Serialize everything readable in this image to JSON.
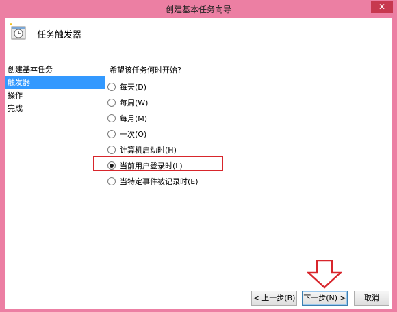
{
  "window": {
    "title": "创建基本任务向导",
    "close_label": "✕"
  },
  "header": {
    "title": "任务触发器",
    "icon": "task-scheduler-icon"
  },
  "sidebar": {
    "items": [
      {
        "label": "创建基本任务",
        "active": false
      },
      {
        "label": "触发器",
        "active": true
      },
      {
        "label": "操作",
        "active": false
      },
      {
        "label": "完成",
        "active": false
      }
    ]
  },
  "content": {
    "question": "希望该任务何时开始?",
    "options": [
      {
        "label": "每天(D)",
        "selected": false
      },
      {
        "label": "每周(W)",
        "selected": false
      },
      {
        "label": "每月(M)",
        "selected": false
      },
      {
        "label": "一次(O)",
        "selected": false
      },
      {
        "label": "计算机启动时(H)",
        "selected": false
      },
      {
        "label": "当前用户登录时(L)",
        "selected": true
      },
      {
        "label": "当特定事件被记录时(E)",
        "selected": false
      }
    ]
  },
  "footer": {
    "back_label": "< 上一步(B)",
    "next_label": "下一步(N) >",
    "cancel_label": "取消"
  },
  "colors": {
    "frame": "#ec7fa3",
    "selection": "#3399ff",
    "highlight": "#d8262c"
  }
}
